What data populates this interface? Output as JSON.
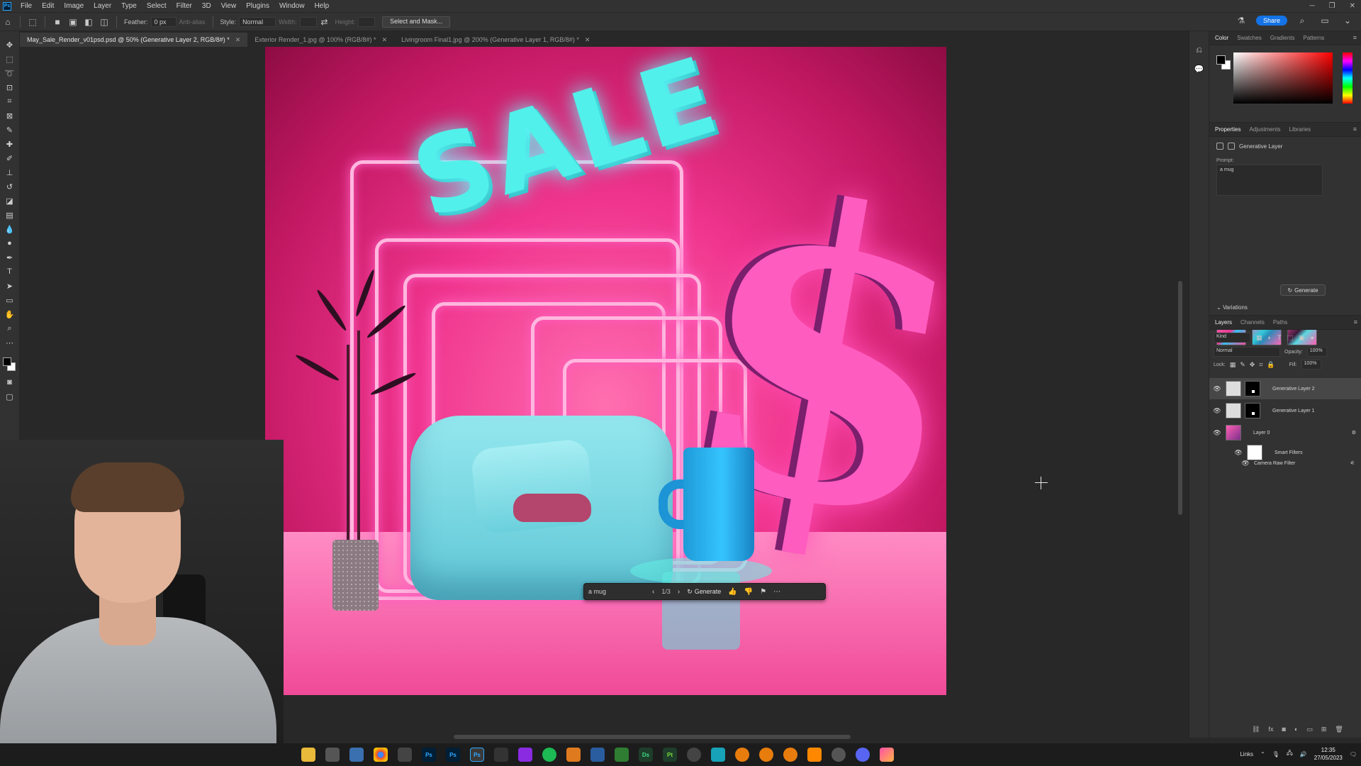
{
  "menubar": {
    "items": [
      "File",
      "Edit",
      "Image",
      "Layer",
      "Type",
      "Select",
      "Filter",
      "3D",
      "View",
      "Plugins",
      "Window",
      "Help"
    ]
  },
  "options": {
    "feather_label": "Feather:",
    "feather_value": "0 px",
    "antialias_label": "Anti-alias",
    "style_label": "Style:",
    "style_value": "Normal",
    "width_label": "Width:",
    "height_label": "Height:",
    "select_mask_label": "Select and Mask...",
    "share_label": "Share"
  },
  "tabs": [
    {
      "label": "May_Sale_Render_v01psd.psd @ 50% (Generative Layer 2, RGB/8#) *",
      "active": true
    },
    {
      "label": "Exterior Render_1.jpg @ 100% (RGB/8#) *",
      "active": false
    },
    {
      "label": "Livingroom Final1.jpg @ 200% (Generative Layer 1, RGB/8#) *",
      "active": false
    }
  ],
  "canvas": {
    "headline": "SALE",
    "symbol": "$"
  },
  "context_bar": {
    "prompt": "a mug",
    "counter": "1/3",
    "generate_label": "Generate"
  },
  "color_panel": {
    "tabs": [
      "Color",
      "Swatches",
      "Gradients",
      "Patterns"
    ]
  },
  "properties_panel": {
    "tabs": [
      "Properties",
      "Adjustments",
      "Libraries"
    ],
    "layer_type": "Generative Layer",
    "prompt_label": "Prompt:",
    "prompt_value": "a mug",
    "generate_label": "Generate",
    "variations_label": "Variations"
  },
  "layers_panel": {
    "tabs": [
      "Layers",
      "Channels",
      "Paths"
    ],
    "kind_label": "Kind",
    "blend_mode": "Normal",
    "opacity_label": "Opacity:",
    "opacity_value": "100%",
    "lock_label": "Lock:",
    "fill_label": "Fill:",
    "fill_value": "100%",
    "layers": [
      {
        "name": "Generative Layer 2",
        "selected": true
      },
      {
        "name": "Generative Layer 1",
        "selected": false
      },
      {
        "name": "Layer 0",
        "selected": false
      },
      {
        "name": "Smart Filters",
        "selected": false
      },
      {
        "name": "Camera Raw Filter",
        "selected": false
      }
    ]
  },
  "taskbar": {
    "links_label": "Links",
    "time": "12:35",
    "date": "27/05/2023",
    "app_labels": [
      "Ps",
      "Ps",
      "Ps",
      "Ds",
      "Pt"
    ]
  },
  "colors": {
    "accent": "#1473e6",
    "panel_bg": "#323232",
    "canvas_bg": "#282828"
  }
}
